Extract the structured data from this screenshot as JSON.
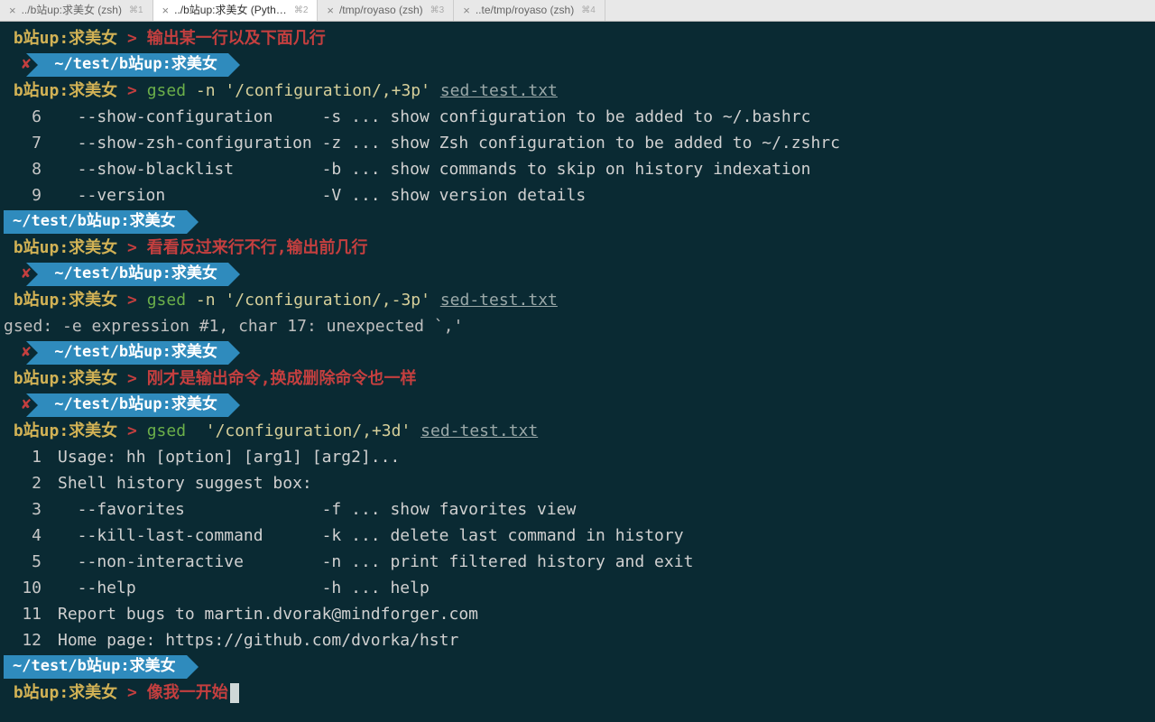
{
  "tabs": [
    {
      "title": "../b站up:求美女 (zsh)",
      "shortcut": "⌘1",
      "active": false
    },
    {
      "title": "../b站up:求美女 (Pyth…",
      "shortcut": "⌘2",
      "active": true
    },
    {
      "title": "/tmp/royaso (zsh)",
      "shortcut": "⌘3",
      "active": false
    },
    {
      "title": "..te/tmp/royaso (zsh)",
      "shortcut": "⌘4",
      "active": false
    }
  ],
  "prompt": {
    "host": "b站up:求美女",
    "sep": " > ",
    "path": "~/test/b站up:求美女"
  },
  "blocks": [
    {
      "type": "cmd",
      "host": "b站up:求美女",
      "comment": "输出某一行以及下面几行"
    },
    {
      "type": "ps",
      "indent": true,
      "err": true,
      "path": "~/test/b站up:求美女"
    },
    {
      "type": "cmd",
      "host": "b站up:求美女",
      "name": "gsed",
      "args": " -n '/configuration/,+3p' ",
      "file": "sed-test.txt"
    },
    {
      "type": "out",
      "n": "6",
      "txt": "  --show-configuration     -s ... show configuration to be added to ~/.bashrc"
    },
    {
      "type": "out",
      "n": "7",
      "txt": "  --show-zsh-configuration -z ... show Zsh configuration to be added to ~/.zshrc"
    },
    {
      "type": "out",
      "n": "8",
      "txt": "  --show-blacklist         -b ... show commands to skip on history indexation"
    },
    {
      "type": "out",
      "n": "9",
      "txt": "  --version                -V ... show version details"
    },
    {
      "type": "ps",
      "indent": false,
      "err": false,
      "path": "~/test/b站up:求美女"
    },
    {
      "type": "cmd",
      "host": "b站up:求美女",
      "comment": "看看反过来行不行,输出前几行"
    },
    {
      "type": "ps",
      "indent": true,
      "err": true,
      "path": "~/test/b站up:求美女"
    },
    {
      "type": "cmd",
      "host": "b站up:求美女",
      "name": "gsed",
      "args": " -n '/configuration/,-3p' ",
      "file": "sed-test.txt"
    },
    {
      "type": "raw",
      "txt": "gsed: -e expression #1, char 17: unexpected `,'"
    },
    {
      "type": "ps",
      "indent": true,
      "err": true,
      "path": "~/test/b站up:求美女"
    },
    {
      "type": "cmd",
      "host": "b站up:求美女",
      "comment": "刚才是输出命令,换成删除命令也一样"
    },
    {
      "type": "ps",
      "indent": true,
      "err": true,
      "path": "~/test/b站up:求美女"
    },
    {
      "type": "cmd",
      "host": "b站up:求美女",
      "name": "gsed",
      "args": "  '/configuration/,+3d' ",
      "file": "sed-test.txt"
    },
    {
      "type": "out",
      "n": "1",
      "txt": "Usage: hh [option] [arg1] [arg2]..."
    },
    {
      "type": "out",
      "n": "2",
      "txt": "Shell history suggest box:"
    },
    {
      "type": "out",
      "n": "3",
      "txt": "  --favorites              -f ... show favorites view"
    },
    {
      "type": "out",
      "n": "4",
      "txt": "  --kill-last-command      -k ... delete last command in history"
    },
    {
      "type": "out",
      "n": "5",
      "txt": "  --non-interactive        -n ... print filtered history and exit"
    },
    {
      "type": "out",
      "n": "10",
      "txt": "  --help                   -h ... help"
    },
    {
      "type": "out",
      "n": "11",
      "txt": "Report bugs to martin.dvorak@mindforger.com"
    },
    {
      "type": "out",
      "n": "12",
      "txt": "Home page: https://github.com/dvorka/hstr"
    },
    {
      "type": "ps",
      "indent": false,
      "err": false,
      "path": "~/test/b站up:求美女"
    },
    {
      "type": "cmd",
      "host": "b站up:求美女",
      "comment": "像我一开始",
      "cursor": true
    }
  ]
}
